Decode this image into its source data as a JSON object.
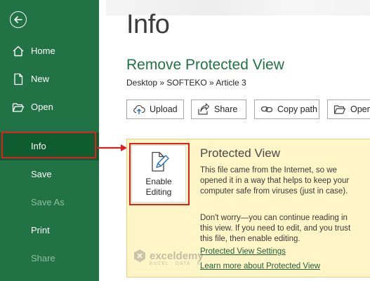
{
  "sidebar": {
    "back_icon": "back-arrow-icon",
    "items": [
      {
        "label": "Home",
        "icon": "home-icon"
      },
      {
        "label": "New",
        "icon": "new-document-icon"
      },
      {
        "label": "Open",
        "icon": "folder-open-icon"
      },
      {
        "label": "Info"
      },
      {
        "label": "Save"
      },
      {
        "label": "Save As"
      },
      {
        "label": "Print"
      },
      {
        "label": "Share"
      }
    ]
  },
  "main": {
    "title": "Info",
    "doc_title": "Remove Protected View",
    "breadcrumb": "Desktop » SOFTEKO » Article 3",
    "buttons": [
      {
        "label": "Upload",
        "icon": "upload-icon"
      },
      {
        "label": "Share",
        "icon": "share-icon"
      },
      {
        "label": "Copy path",
        "icon": "link-icon"
      },
      {
        "label": "Open",
        "icon": "folder-open-icon"
      }
    ]
  },
  "protected_view": {
    "enable_line1": "Enable",
    "enable_line2": "Editing",
    "heading": "Protected View",
    "para1": "This file came from the Internet, so we opened it in a way that helps to keep your computer safe from viruses (just in case).",
    "para2": "Don't worry—you can continue reading in this view. If you need to edit, and you trust this file, then enable editing.",
    "link_settings": "Protected View Settings",
    "link_learn": "Learn more about Protected View"
  },
  "watermark": {
    "name": "exceldemy",
    "sub": "EXCEL · DATA · BI"
  },
  "colors": {
    "sidebar": "#217346",
    "accent_red": "#e0201f",
    "panel": "#fff5c7"
  }
}
